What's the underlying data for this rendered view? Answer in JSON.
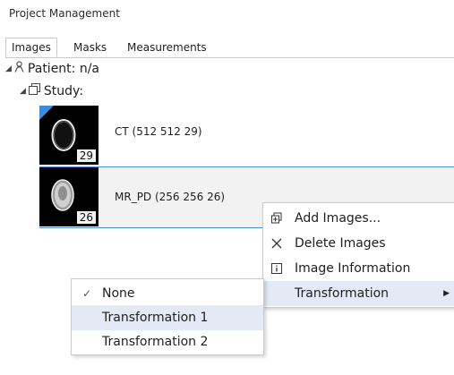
{
  "panel": {
    "title": "Project Management"
  },
  "tabs": [
    {
      "label": "Images"
    },
    {
      "label": "Masks"
    },
    {
      "label": "Measurements"
    }
  ],
  "tree": {
    "patient_label": "Patient: n/a",
    "study_label": "Study:",
    "images": [
      {
        "label": "CT (512 512 29)",
        "count": "29"
      },
      {
        "label": "MR_PD (256 256 26)",
        "count": "26"
      }
    ]
  },
  "context_menu": {
    "items": [
      {
        "label": "Add Images...",
        "icon": "add-images-icon"
      },
      {
        "label": "Delete Images",
        "icon": "close-icon"
      },
      {
        "label": "Image Information",
        "icon": "info-icon"
      },
      {
        "label": "Transformation"
      }
    ]
  },
  "transformation_menu": {
    "items": [
      {
        "label": "None"
      },
      {
        "label": "Transformation 1"
      },
      {
        "label": "Transformation 2"
      }
    ]
  },
  "colors": {
    "selection_border": "#4a90e2",
    "menu_highlight": "#e3e9f5",
    "corner_flag": "#3d8bdb"
  }
}
